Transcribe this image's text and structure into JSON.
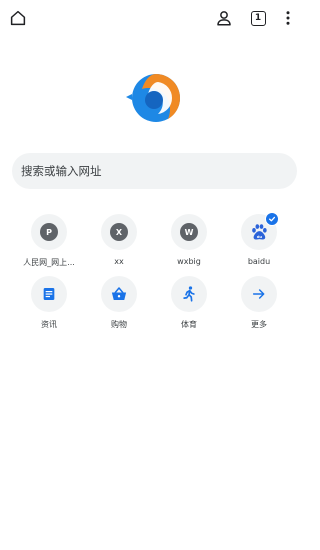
{
  "toolbar": {
    "home_icon": "home-icon",
    "account_icon": "account-icon",
    "tab_count": "1",
    "menu_icon": "more-vert-icon"
  },
  "search": {
    "placeholder": "搜索或输入网址"
  },
  "shortcuts": [
    {
      "label": "人民网_网上...",
      "letter": "P",
      "icon": "letter-icon"
    },
    {
      "label": "xx",
      "letter": "X",
      "icon": "letter-icon"
    },
    {
      "label": "wxbig",
      "letter": "W",
      "icon": "letter-icon"
    },
    {
      "label": "baidu",
      "icon": "baidu-paw-icon",
      "badge": "check-badge-icon"
    },
    {
      "label": "资讯",
      "icon": "news-icon"
    },
    {
      "label": "购物",
      "icon": "shopping-basket-icon"
    },
    {
      "label": "体育",
      "icon": "running-icon"
    },
    {
      "label": "更多",
      "icon": "arrow-right-icon"
    }
  ],
  "colors": {
    "accent_blue": "#1a73e8",
    "tile_bg": "#f1f3f4",
    "letter_bg": "#5f6368",
    "logo_orange": "#f08a24",
    "logo_blue": "#1e88e5"
  }
}
